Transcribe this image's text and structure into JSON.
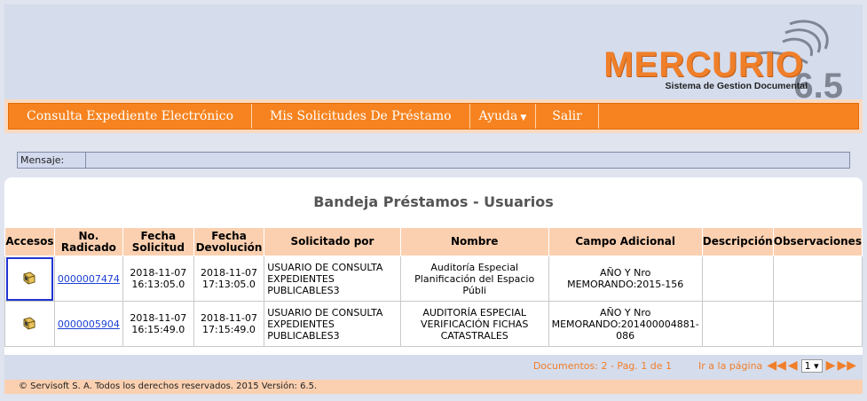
{
  "logo": {
    "brand": "MERCURIO",
    "subtitle": "Sistema de Gestion Documental",
    "version": "6.5"
  },
  "nav": {
    "items": [
      {
        "label": "Consulta Expediente Electrónico"
      },
      {
        "label": "Mis Solicitudes De Préstamo"
      },
      {
        "label": "Ayuda"
      },
      {
        "label": "Salir"
      }
    ]
  },
  "message": {
    "label": "Mensaje:",
    "value": ""
  },
  "page": {
    "title": "Bandeja Préstamos - Usuarios"
  },
  "table": {
    "headers": [
      "Accesos",
      "No. Radicado",
      "Fecha Solicitud",
      "Fecha Devolución",
      "Solicitado por",
      "Nombre",
      "Campo Adicional",
      "Descripción",
      "Observaciones"
    ],
    "rows": [
      {
        "radicado": "0000007474",
        "fecha_solicitud": "2018-11-07 16:13:05.0",
        "fecha_devolucion": "2018-11-07 17:13:05.0",
        "solicitado_por": "USUARIO DE CONSULTA EXPEDIENTES PUBLICABLES3",
        "nombre": "Auditoría Especial Planificación del Espacio Públi",
        "campo_adicional": "AÑO Y Nro MEMORANDO:2015-156",
        "descripcion": "",
        "observaciones": ""
      },
      {
        "radicado": "0000005904",
        "fecha_solicitud": "2018-11-07 16:15:49.0",
        "fecha_devolucion": "2018-11-07 17:15:49.0",
        "solicitado_por": "USUARIO DE CONSULTA EXPEDIENTES PUBLICABLES3",
        "nombre": "AUDITORÍA ESPECIAL VERIFICACIÓN FICHAS CATASTRALES",
        "campo_adicional": "AÑO Y Nro MEMORANDO:201400004881-086",
        "descripcion": "",
        "observaciones": ""
      }
    ]
  },
  "pagination": {
    "documents": "Documentos: 2  -  Pag. 1 de 1",
    "goto": "Ir a la página",
    "page_select": "1"
  },
  "footer": {
    "copyright": "© Servisoft S. A. Todos los derechos reservados. 2015 Versión: 6.5."
  }
}
